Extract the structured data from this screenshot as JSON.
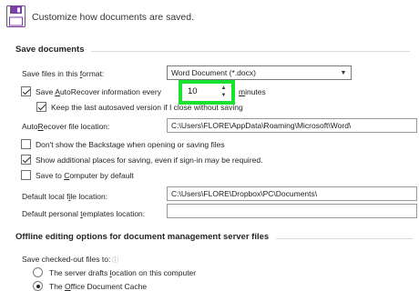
{
  "header": {
    "text": "Customize how documents are saved."
  },
  "save_documents": {
    "title": "Save documents",
    "format": {
      "label": "Save files in this format:",
      "value": "Word Document (*.docx)"
    },
    "autorecover": {
      "label": "Save AutoRecover information every",
      "checked": true,
      "minutes_value": "10",
      "minutes_label": "minutes"
    },
    "keep_last": {
      "label": "Keep the last autosaved version if I close without saving",
      "checked": true
    },
    "autorecover_location": {
      "label": "AutoRecover file location:",
      "value": "C:\\Users\\FLORE\\AppData\\Roaming\\Microsoft\\Word\\"
    },
    "dont_show_backstage": {
      "label": "Don't show the Backstage when opening or saving files",
      "checked": false
    },
    "show_additional": {
      "label": "Show additional places for saving, even if sign-in may be required.",
      "checked": true
    },
    "save_to_computer": {
      "label": "Save to Computer by default",
      "checked": false
    },
    "default_local": {
      "label": "Default local file location:",
      "value": "C:\\Users\\FLORE\\Dropbox\\PC\\Documents\\"
    },
    "default_templates": {
      "label": "Default personal templates location:",
      "value": ""
    }
  },
  "offline": {
    "title": "Offline editing options for document management server files",
    "checked_out_label": "Save checked-out files to:",
    "options": [
      {
        "label": "The server drafts location on this computer",
        "checked": false
      },
      {
        "label": "The Office Document Cache",
        "checked": true
      }
    ]
  }
}
